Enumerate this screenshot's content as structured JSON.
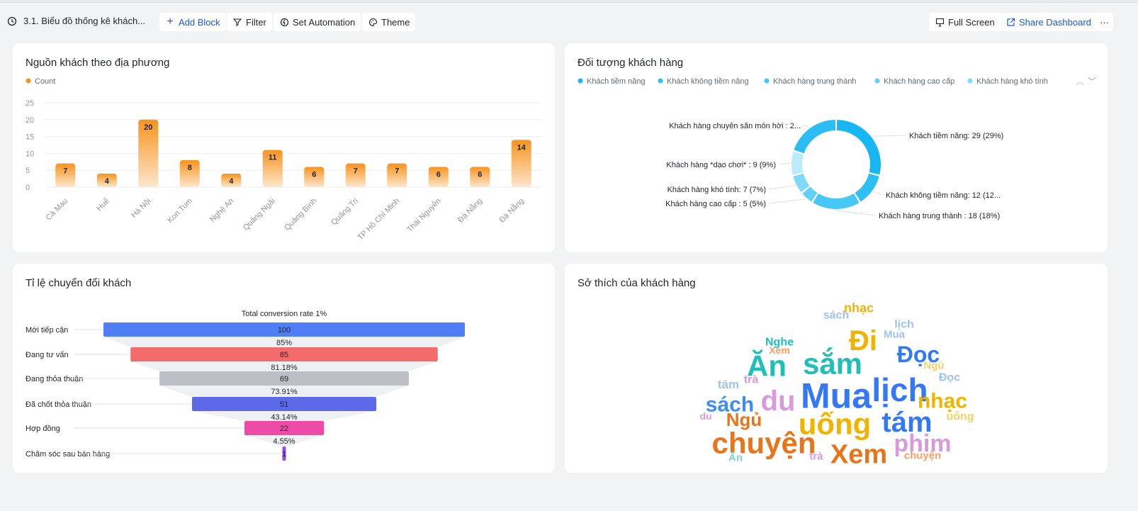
{
  "toolbar": {
    "title": "3.1. Biểu đồ thống kê khách...",
    "add_block": "Add Block",
    "filter": "Filter",
    "set_automation": "Set Automation",
    "theme": "Theme",
    "full_screen": "Full Screen",
    "share_dashboard": "Share Dashboard",
    "more": "···"
  },
  "colors": {
    "accent": "#1456f0",
    "bar": "#f7931e",
    "donut": "#24c3f7"
  },
  "cards": {
    "bar": {
      "title": "Nguồn khách theo địa phương"
    },
    "donut": {
      "title": "Đối tượng khách hàng"
    },
    "funnel": {
      "title": "Tỉ lệ chuyển đổi khách"
    },
    "cloud": {
      "title": "Sở thích của khách hàng"
    }
  },
  "chart_data": [
    {
      "id": "bar",
      "type": "bar",
      "legend": [
        "Count"
      ],
      "categories": [
        "Cà Mau",
        "Huế",
        "Hà Nội",
        "Kon Tum",
        "Nghệ An",
        "Quảng Ngãi",
        "Quảng Bình",
        "Quảng Trị",
        "TP Hồ Chí Minh",
        "Thái Nguyên",
        "Đà Nẵng",
        "Đà Nẵng"
      ],
      "values": [
        7,
        4,
        20,
        8,
        4,
        11,
        6,
        7,
        7,
        6,
        6,
        14
      ],
      "yticks": [
        "0",
        "5",
        "10",
        "15",
        "20",
        "25"
      ],
      "ylim": [
        0,
        25
      ],
      "grid": true,
      "legend_position": "top-left"
    },
    {
      "id": "donut",
      "type": "pie",
      "legend": [
        "Khách tiềm năng",
        "Khách không tiềm năng",
        "Khách hàng trung thành",
        "Khách hàng cao cấp",
        "Khách hàng khó tính"
      ],
      "slices": [
        {
          "label": "Khách tiềm năng: 29 (29%)",
          "value": 29,
          "color": "#18b7f2"
        },
        {
          "label": "Khách không tiềm năng: 12 (12...",
          "value": 12,
          "color": "#2ec0f4"
        },
        {
          "label": "Khách hàng trung thành : 18 (18%)",
          "value": 18,
          "color": "#45c8f6"
        },
        {
          "label": "Khách hàng cao cấp : 5 (5%)",
          "value": 5,
          "color": "#62d0f7"
        },
        {
          "label": "Khách hàng khó tính: 7 (7%)",
          "value": 7,
          "color": "#7fd9f8"
        },
        {
          "label": "Khách hàng *dạo chơi* : 9 (9%)",
          "value": 9,
          "color": "#b9ebfb"
        },
        {
          "label": "Khách hàng chuyên săn món hời : 2...",
          "value": 20,
          "color": "#2bbdf4"
        }
      ]
    },
    {
      "id": "funnel",
      "type": "bar",
      "title": "Total conversion rate 1%",
      "categories": [
        "Mới tiếp cận",
        "Đang tư vấn",
        "Đang thỏa thuận",
        "Đã chốt thỏa thuận",
        "Hợp đồng",
        "Chăm sóc sau bán hàng"
      ],
      "values": [
        100,
        85,
        69,
        51,
        22,
        1
      ],
      "value_labels": [
        "100",
        "85",
        "69",
        "51",
        "22",
        "1"
      ],
      "conversion": [
        "85%",
        "81.18%",
        "73.91%",
        "43.14%",
        "4.55%"
      ],
      "colors": [
        "#4e7ff7",
        "#f46b6b",
        "#bcbfc5",
        "#5d6ae8",
        "#ec4ca6",
        "#8a55e0"
      ]
    }
  ],
  "word_cloud": [
    {
      "text": "Mua",
      "size": 50,
      "color": "#3478f6",
      "x": 1180,
      "y": 558
    },
    {
      "text": "lịch",
      "size": 46,
      "color": "#3478f6",
      "x": 1270,
      "y": 550
    },
    {
      "text": "sắm",
      "size": 42,
      "color": "#1fbfb8",
      "x": 1175,
      "y": 513
    },
    {
      "text": "Ăn",
      "size": 42,
      "color": "#1fbfb8",
      "x": 1082,
      "y": 516
    },
    {
      "text": "Đi",
      "size": 40,
      "color": "#f0b400",
      "x": 1218,
      "y": 480
    },
    {
      "text": "Đọc",
      "size": 32,
      "color": "#3478f6",
      "x": 1296,
      "y": 500
    },
    {
      "text": "du",
      "size": 40,
      "color": "#d89ad8",
      "x": 1098,
      "y": 565
    },
    {
      "text": "sách",
      "size": 30,
      "color": "#3d8ef0",
      "x": 1030,
      "y": 570
    },
    {
      "text": "uống",
      "size": 42,
      "color": "#f0b400",
      "x": 1178,
      "y": 598
    },
    {
      "text": "tám",
      "size": 40,
      "color": "#3478f6",
      "x": 1280,
      "y": 595
    },
    {
      "text": "nhạc",
      "size": 30,
      "color": "#f0b400",
      "x": 1330,
      "y": 565
    },
    {
      "text": "Ngủ",
      "size": 26,
      "color": "#e8751a",
      "x": 1050,
      "y": 592
    },
    {
      "text": "chuyện",
      "size": 42,
      "color": "#e8751a",
      "x": 1078,
      "y": 625
    },
    {
      "text": "Xem",
      "size": 38,
      "color": "#e8751a",
      "x": 1212,
      "y": 640
    },
    {
      "text": "phim",
      "size": 34,
      "color": "#d89ad8",
      "x": 1302,
      "y": 625
    },
    {
      "text": "Nghe",
      "size": 16,
      "color": "#1fbfb8",
      "x": 1100,
      "y": 482
    },
    {
      "text": "Xem",
      "size": 14,
      "color": "#f3a06a",
      "x": 1100,
      "y": 494
    },
    {
      "text": "nhạc",
      "size": 18,
      "color": "#f0b400",
      "x": 1212,
      "y": 434
    },
    {
      "text": "sách",
      "size": 16,
      "color": "#9ec3f0",
      "x": 1180,
      "y": 444
    },
    {
      "text": "lịch",
      "size": 16,
      "color": "#9ec3f0",
      "x": 1276,
      "y": 457
    },
    {
      "text": "Mua",
      "size": 15,
      "color": "#9ec3f0",
      "x": 1262,
      "y": 471
    },
    {
      "text": "tám",
      "size": 17,
      "color": "#9ec3f0",
      "x": 1028,
      "y": 542
    },
    {
      "text": "trà",
      "size": 16,
      "color": "#d89ad8",
      "x": 1060,
      "y": 535
    },
    {
      "text": "Đọc",
      "size": 16,
      "color": "#9ec3f0",
      "x": 1340,
      "y": 532
    },
    {
      "text": "uống",
      "size": 16,
      "color": "#f7cf6a",
      "x": 1355,
      "y": 587
    },
    {
      "text": "chuyện",
      "size": 15,
      "color": "#f3a06a",
      "x": 1302,
      "y": 642
    },
    {
      "text": "Ăn",
      "size": 15,
      "color": "#7ad6d2",
      "x": 1038,
      "y": 645
    },
    {
      "text": "trà",
      "size": 15,
      "color": "#d89ad8",
      "x": 1152,
      "y": 643
    },
    {
      "text": "du",
      "size": 14,
      "color": "#d89ad8",
      "x": 996,
      "y": 587
    },
    {
      "text": "Ngủ",
      "size": 15,
      "color": "#f7cf6a",
      "x": 1318,
      "y": 515
    }
  ]
}
